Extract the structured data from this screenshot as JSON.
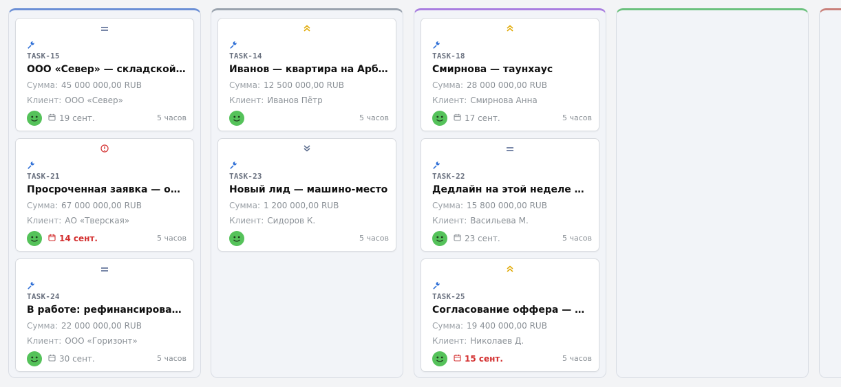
{
  "columns": [
    {
      "accent": "#6b8fd6",
      "cards": [
        {
          "priority": "medium",
          "id": "TASK-15",
          "title": "ООО «Север» — складской комплекс",
          "sum_label": "Сумма:",
          "sum": "45 000 000,00 RUB",
          "client_label": "Клиент:",
          "client": "ООО «Север»",
          "date": "19 сент.",
          "overdue": false,
          "hours": "5 часов"
        },
        {
          "priority": "urgent",
          "id": "TASK-21",
          "title": "Просроченная заявка — офис на Тверской",
          "sum_label": "Сумма:",
          "sum": "67 000 000,00 RUB",
          "client_label": "Клиент:",
          "client": "АО «Тверская»",
          "date": "14 сент.",
          "overdue": true,
          "hours": "5 часов"
        },
        {
          "priority": "medium",
          "id": "TASK-24",
          "title": "В работе: рефинансирование",
          "sum_label": "Сумма:",
          "sum": "22 000 000,00 RUB",
          "client_label": "Клиент:",
          "client": "ООО «Горизонт»",
          "date": "30 сент.",
          "overdue": false,
          "hours": "5 часов"
        }
      ]
    },
    {
      "accent": "#9aa3ae",
      "cards": [
        {
          "priority": "high",
          "id": "TASK-14",
          "title": "Иванов — квартира на Арбате",
          "sum_label": "Сумма:",
          "sum": "12 500 000,00 RUB",
          "client_label": "Клиент:",
          "client": "Иванов Пётр",
          "date": "",
          "overdue": false,
          "hours": "5 часов"
        },
        {
          "priority": "low",
          "id": "TASK-23",
          "title": "Новый лид — машино-место",
          "sum_label": "Сумма:",
          "sum": "1 200 000,00 RUB",
          "client_label": "Клиент:",
          "client": "Сидоров К.",
          "date": "",
          "overdue": false,
          "hours": "5 часов"
        }
      ]
    },
    {
      "accent": "#a97ee0",
      "cards": [
        {
          "priority": "high",
          "id": "TASK-18",
          "title": "Смирнова — таунхаус",
          "sum_label": "Сумма:",
          "sum": "28 000 000,00 RUB",
          "client_label": "Клиент:",
          "client": "Смирнова Анна",
          "date": "17 сент.",
          "overdue": false,
          "hours": "5 часов"
        },
        {
          "priority": "medium",
          "id": "TASK-22",
          "title": "Дедлайн на этой неделе — дом в Подмосковье",
          "sum_label": "Сумма:",
          "sum": "15 800 000,00 RUB",
          "client_label": "Клиент:",
          "client": "Васильева М.",
          "date": "23 сент.",
          "overdue": false,
          "hours": "5 часов"
        },
        {
          "priority": "high",
          "id": "TASK-25",
          "title": "Согласование оффера — ЖК «Река»",
          "sum_label": "Сумма:",
          "sum": "19 400 000,00 RUB",
          "client_label": "Клиент:",
          "client": "Николаев Д.",
          "date": "15 сент.",
          "overdue": true,
          "hours": "5 часов"
        }
      ]
    },
    {
      "accent": "#6cc17e",
      "cards": []
    },
    {
      "accent": "#c9807a",
      "cards": []
    }
  ],
  "colors": {
    "priority_medium": "#4a5f8a",
    "priority_high": "#e0a800",
    "priority_low": "#5a6b8c",
    "priority_urgent": "#d32f2f",
    "type_icon": "#2f6fd6",
    "avatar": "#55c25a",
    "overdue": "#d32f2f"
  },
  "icons": {
    "priority_medium": "equals-icon",
    "priority_high": "double-chevron-up-icon",
    "priority_low": "double-chevron-down-icon",
    "priority_urgent": "alert-circle-icon",
    "task_type": "wrench-icon",
    "date": "calendar-icon",
    "avatar": "smiley-avatar"
  }
}
